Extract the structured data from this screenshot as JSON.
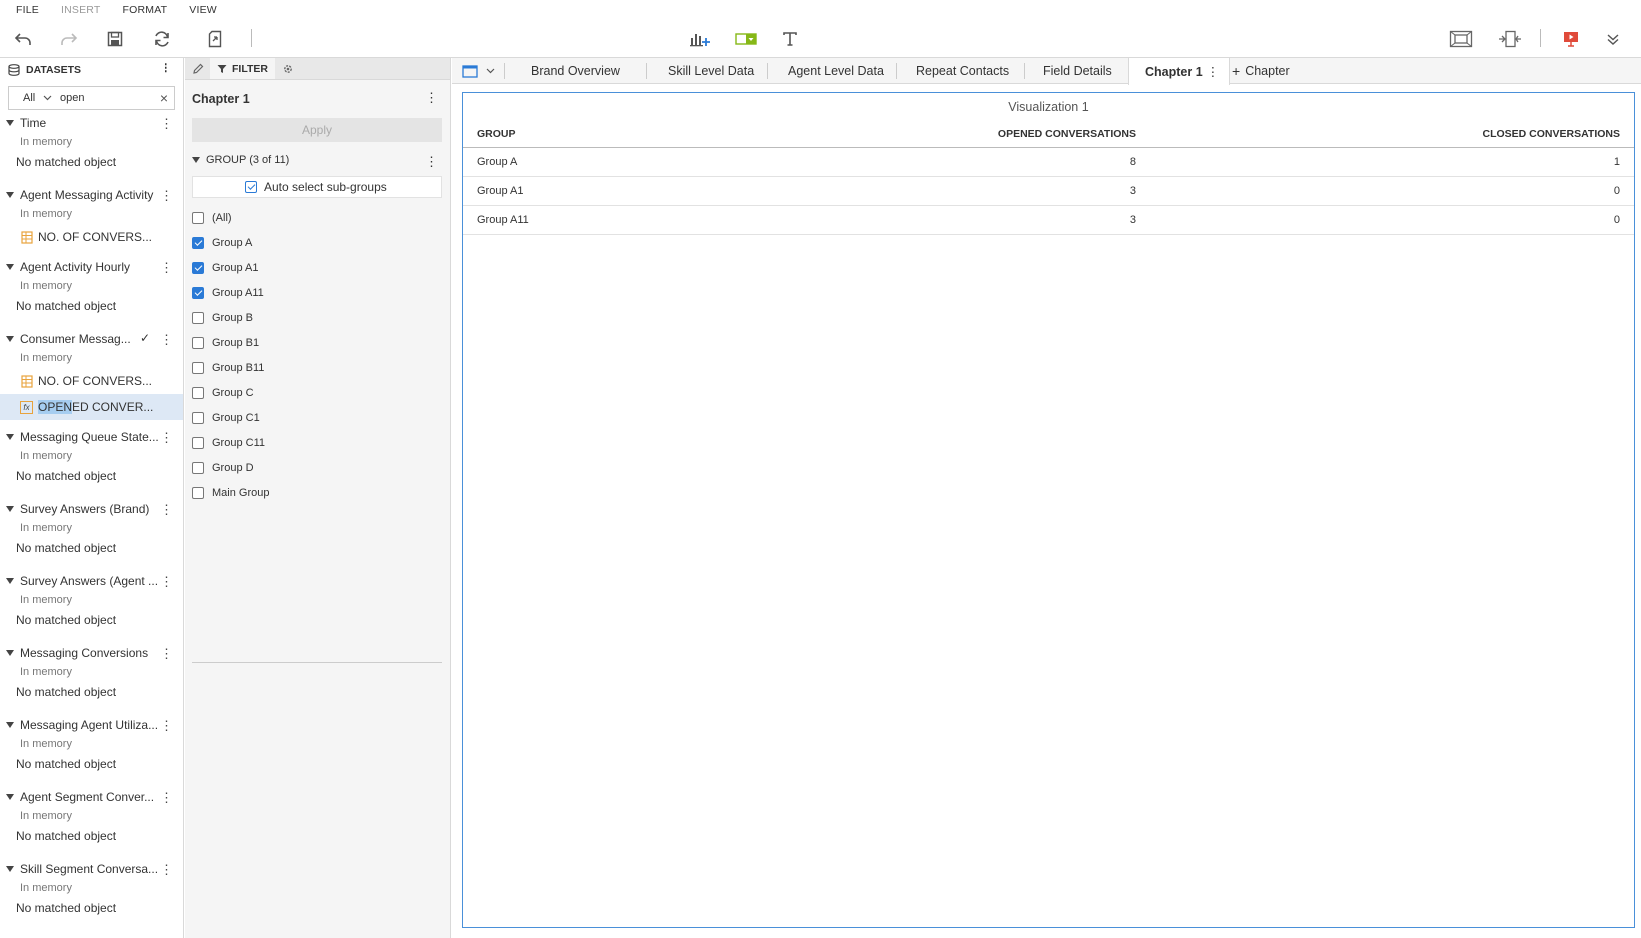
{
  "menu": [
    "FILE",
    "INSERT",
    "FORMAT",
    "VIEW"
  ],
  "menu_disabled": [
    false,
    true,
    false,
    false
  ],
  "datasets_panel": {
    "title": "DATASETS",
    "search": {
      "type": "All",
      "value": "open"
    },
    "items": [
      {
        "name": "Time",
        "status": "In memory",
        "result": "No matched object"
      },
      {
        "name": "Agent Messaging Activity",
        "status": "In memory",
        "field": "NO. OF CONVERS..."
      },
      {
        "name": "Agent Activity Hourly",
        "status": "In memory",
        "result": "No matched object"
      },
      {
        "name": "Consumer Messag...",
        "status": "In memory",
        "field": "NO. OF CONVERS...",
        "field2_highlight": "OPEN",
        "field2_rest": "ED CONVER..."
      },
      {
        "name": "Messaging Queue State...",
        "status": "In memory",
        "result": "No matched object"
      },
      {
        "name": "Survey Answers (Brand)",
        "status": "In memory",
        "result": "No matched object"
      },
      {
        "name": "Survey Answers (Agent ...",
        "status": "In memory",
        "result": "No matched object"
      },
      {
        "name": "Messaging Conversions",
        "status": "In memory",
        "result": "No matched object"
      },
      {
        "name": "Messaging Agent Utiliza...",
        "status": "In memory",
        "result": "No matched object"
      },
      {
        "name": "Agent Segment Conver...",
        "status": "In memory",
        "result": "No matched object"
      },
      {
        "name": "Skill Segment Conversa...",
        "status": "In memory",
        "result": "No matched object"
      }
    ]
  },
  "filter_panel": {
    "tab_label": "FILTER",
    "chapter_title": "Chapter 1",
    "apply_label": "Apply",
    "group_header": "GROUP (3 of 11)",
    "auto_select_label": "Auto select sub-groups",
    "options": [
      {
        "label": "(All)",
        "checked": false
      },
      {
        "label": "Group A",
        "checked": true
      },
      {
        "label": "Group A1",
        "checked": true
      },
      {
        "label": "Group A11",
        "checked": true
      },
      {
        "label": "Group B",
        "checked": false
      },
      {
        "label": "Group B1",
        "checked": false
      },
      {
        "label": "Group B11",
        "checked": false
      },
      {
        "label": "Group C",
        "checked": false
      },
      {
        "label": "Group C1",
        "checked": false
      },
      {
        "label": "Group C11",
        "checked": false
      },
      {
        "label": "Group D",
        "checked": false
      },
      {
        "label": "Main Group",
        "checked": false
      }
    ]
  },
  "tabs": [
    "Brand Overview",
    "Skill Level Data",
    "Agent Level Data",
    "Repeat Contacts",
    "Field Details",
    "Chapter 1"
  ],
  "add_chapter_label": "Chapter",
  "visualization": {
    "title": "Visualization 1",
    "columns": [
      "GROUP",
      "OPENED CONVERSATIONS",
      "CLOSED CONVERSATIONS"
    ],
    "rows": [
      [
        "Group A",
        "8",
        "1"
      ],
      [
        "Group A1",
        "3",
        "0"
      ],
      [
        "Group A11",
        "3",
        "0"
      ]
    ]
  },
  "colors": {
    "accent": "#2a7ad6",
    "selection": "#dde8f5",
    "highlight": "#a6cdf0",
    "field_icon": "#e8a33d"
  }
}
